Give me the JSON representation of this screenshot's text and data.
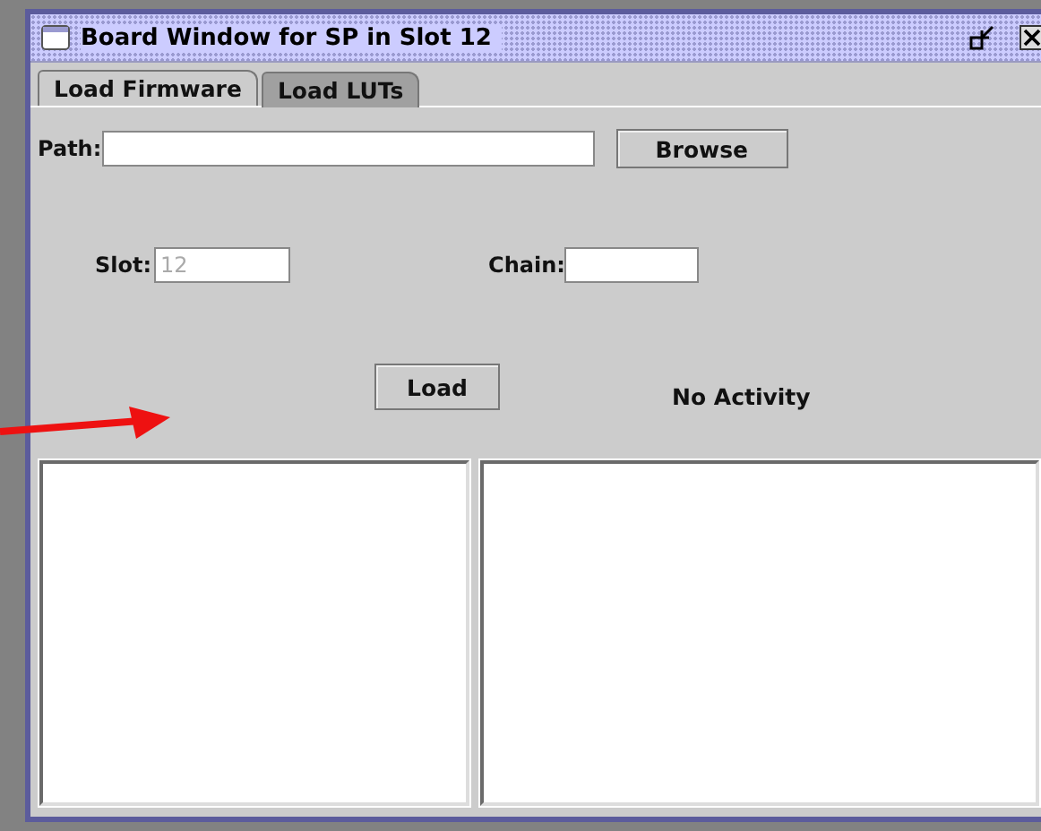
{
  "window": {
    "title": "Board Window for SP in Slot 12"
  },
  "tabs": [
    {
      "label": "Load Firmware",
      "selected": true
    },
    {
      "label": "Load LUTs",
      "selected": false
    }
  ],
  "path": {
    "label": "Path:",
    "button": "Browse"
  },
  "slot": {
    "label": "Slot:",
    "value": "12",
    "disabled": true
  },
  "chain": {
    "label": "Chain:"
  },
  "load_button": "Load",
  "status": "No Activity"
}
